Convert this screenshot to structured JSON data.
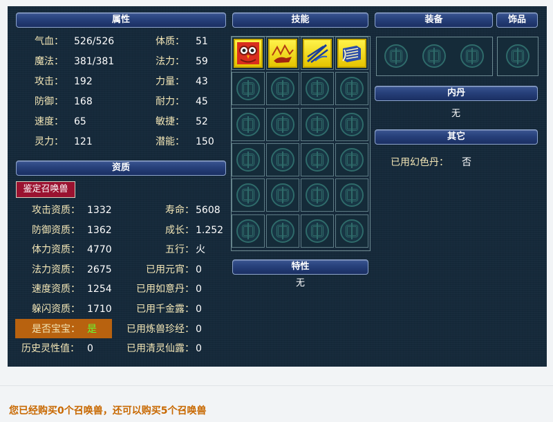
{
  "attributes": {
    "header": "属性",
    "rows": [
      {
        "l1": "气血：",
        "v1": "526/526",
        "l2": "体质：",
        "v2": "51"
      },
      {
        "l1": "魔法：",
        "v1": "381/381",
        "l2": "法力：",
        "v2": "59"
      },
      {
        "l1": "攻击：",
        "v1": "192",
        "l2": "力量：",
        "v2": "43"
      },
      {
        "l1": "防御：",
        "v1": "168",
        "l2": "耐力：",
        "v2": "45"
      },
      {
        "l1": "速度：",
        "v1": "65",
        "l2": "敏捷：",
        "v2": "52"
      },
      {
        "l1": "灵力：",
        "v1": "121",
        "l2": "潜能：",
        "v2": "150"
      }
    ]
  },
  "aptitude": {
    "header": "资质",
    "button_label": "鉴定召唤兽",
    "rows": [
      {
        "l1": "攻击资质：",
        "v1": "1332",
        "l2": "寿命：",
        "v2": "5608"
      },
      {
        "l1": "防御资质：",
        "v1": "1362",
        "l2": "成长：",
        "v2": "1.252"
      },
      {
        "l1": "体力资质：",
        "v1": "4770",
        "l2": "五行：",
        "v2": "火"
      },
      {
        "l1": "法力资质：",
        "v1": "2675",
        "l2": "已用元宵：",
        "v2": "0"
      },
      {
        "l1": "速度资质：",
        "v1": "1254",
        "l2": "已用如意丹：",
        "v2": "0"
      },
      {
        "l1": "躲闪资质：",
        "v1": "1710",
        "l2": "已用千金露：",
        "v2": "0"
      },
      {
        "l1": "是否宝宝：",
        "v1": "是",
        "l2": "已用炼兽珍经：",
        "v2": "0"
      },
      {
        "l1": "历史灵性值：",
        "v1": "0",
        "l2": "已用清灵仙露：",
        "v2": "0"
      }
    ],
    "highlight_color": "#b8620f",
    "baobao_value_color": "#66ff33"
  },
  "skills": {
    "header": "技能",
    "icons": [
      "owl-skill-icon",
      "fox-skill-icon",
      "blue-claw-skill-icon",
      "scroll-skill-icon"
    ],
    "empty_slot_count": 20
  },
  "traits": {
    "header": "特性",
    "value": "无"
  },
  "equipment": {
    "header": "装备",
    "slot_count": 3
  },
  "accessory": {
    "header": "饰品",
    "slot_count": 1
  },
  "inner_pill": {
    "header": "内丹",
    "value": "无"
  },
  "other": {
    "header": "其它",
    "label": "已用幻色丹：",
    "value": "否"
  },
  "footer": "您已经购买0个召唤兽，还可以购买5个召唤兽"
}
